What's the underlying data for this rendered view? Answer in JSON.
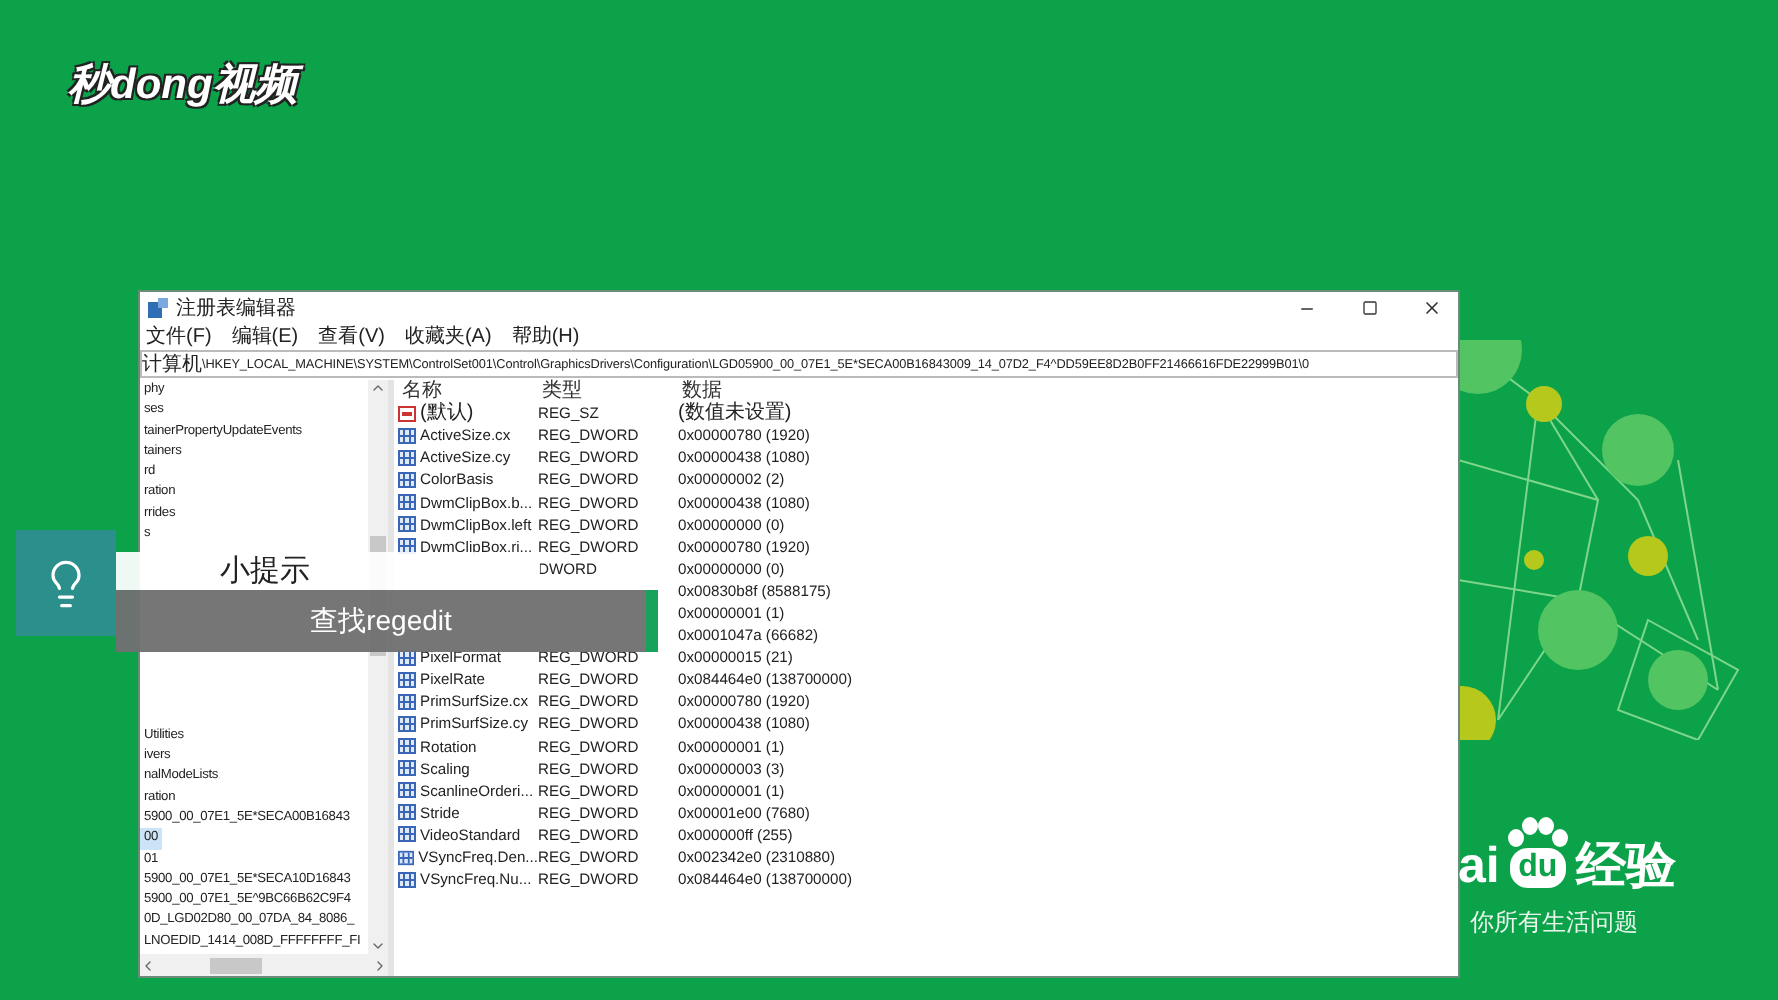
{
  "brand_logo": "秒dong视频",
  "window": {
    "title": "注册表编辑器",
    "menu": [
      "文件(F)",
      "编辑(E)",
      "查看(V)",
      "收藏夹(A)",
      "帮助(H)"
    ],
    "address": {
      "root": "计算机",
      "path": "\\HKEY_LOCAL_MACHINE\\SYSTEM\\ControlSet001\\Control\\GraphicsDrivers\\Configuration\\LGD05900_00_07E1_5E*SECA00B16843009_14_07D2_F4^DD59EE8D2B0FF21466616FDE22999B01\\0"
    },
    "tree": {
      "top_items": [
        {
          "label": "phy",
          "selected": false
        },
        {
          "label": "ses",
          "selected": false
        },
        {
          "label": "tainerPropertyUpdateEvents",
          "selected": false
        },
        {
          "label": "tainers",
          "selected": false
        },
        {
          "label": "rd",
          "selected": false
        },
        {
          "label": "ration",
          "selected": false
        },
        {
          "label": "rrides",
          "selected": false
        },
        {
          "label": "s",
          "selected": false
        }
      ],
      "bottom_items": [
        {
          "label": "Utilities",
          "selected": false
        },
        {
          "label": "ivers",
          "selected": false
        },
        {
          "label": "nalModeLists",
          "selected": false
        },
        {
          "label": "ration",
          "selected": false
        },
        {
          "label": "5900_00_07E1_5E*SECA00B16843",
          "selected": false
        },
        {
          "label": "00",
          "selected": true
        },
        {
          "label": "01",
          "selected": false
        },
        {
          "label": "5900_00_07E1_5E*SECA10D16843",
          "selected": false
        },
        {
          "label": "5900_00_07E1_5E^9BC66B62C9F4",
          "selected": false
        },
        {
          "label": "0D_LGD02D80_00_07DA_84_8086_",
          "selected": false
        },
        {
          "label": "LNOEDID_1414_008D_FFFFFFFF_FI",
          "selected": false
        }
      ]
    },
    "columns": [
      "名称",
      "类型",
      "数据"
    ],
    "values": [
      {
        "kind": "string",
        "name": "(默认)",
        "type": "REG_SZ",
        "data": "(数值未设置)"
      },
      {
        "kind": "dword",
        "name": "ActiveSize.cx",
        "type": "REG_DWORD",
        "data": "0x00000780 (1920)"
      },
      {
        "kind": "dword",
        "name": "ActiveSize.cy",
        "type": "REG_DWORD",
        "data": "0x00000438 (1080)"
      },
      {
        "kind": "dword",
        "name": "ColorBasis",
        "type": "REG_DWORD",
        "data": "0x00000002 (2)"
      },
      {
        "kind": "dword",
        "name": "DwmClipBox.b...",
        "type": "REG_DWORD",
        "data": "0x00000438 (1080)"
      },
      {
        "kind": "dword",
        "name": "DwmClipBox.left",
        "type": "REG_DWORD",
        "data": "0x00000000 (0)"
      },
      {
        "kind": "dword",
        "name": "DwmClipBox.ri...",
        "type": "REG_DWORD",
        "data": "0x00000780 (1920)"
      },
      {
        "type": "DWORD",
        "data": "0x00000000 (0)"
      },
      {
        "data": "0x00830b8f (8588175)"
      },
      {
        "data": "0x00000001 (1)"
      },
      {
        "data": "0x0001047a (66682)"
      },
      {
        "kind": "dword",
        "name": "PixelFormat",
        "type": "REG_DWORD",
        "data": "0x00000015 (21)"
      },
      {
        "kind": "dword",
        "name": "PixelRate",
        "type": "REG_DWORD",
        "data": "0x084464e0 (138700000)"
      },
      {
        "kind": "dword",
        "name": "PrimSurfSize.cx",
        "type": "REG_DWORD",
        "data": "0x00000780 (1920)"
      },
      {
        "kind": "dword",
        "name": "PrimSurfSize.cy",
        "type": "REG_DWORD",
        "data": "0x00000438 (1080)"
      },
      {
        "kind": "dword",
        "name": "Rotation",
        "type": "REG_DWORD",
        "data": "0x00000001 (1)"
      },
      {
        "kind": "dword",
        "name": "Scaling",
        "type": "REG_DWORD",
        "data": "0x00000003 (3)"
      },
      {
        "kind": "dword",
        "name": "ScanlineOrderi...",
        "type": "REG_DWORD",
        "data": "0x00000001 (1)"
      },
      {
        "kind": "dword",
        "name": "Stride",
        "type": "REG_DWORD",
        "data": "0x00001e00 (7680)"
      },
      {
        "kind": "dword",
        "name": "VideoStandard",
        "type": "REG_DWORD",
        "data": "0x000000ff (255)"
      },
      {
        "kind": "dword",
        "name": "VSyncFreq.Den...",
        "type": "REG_DWORD",
        "data": "0x002342e0 (2310880)"
      },
      {
        "kind": "dword",
        "name": "VSyncFreq.Nu...",
        "type": "REG_DWORD",
        "data": "0x084464e0 (138700000)"
      }
    ]
  },
  "tip": {
    "heading": "小提示",
    "text": "查找regedit"
  },
  "baidu": {
    "logo_left": "ai",
    "logo_mark": "du",
    "logo_right": "经验",
    "slogan": "你所有生活问题"
  }
}
